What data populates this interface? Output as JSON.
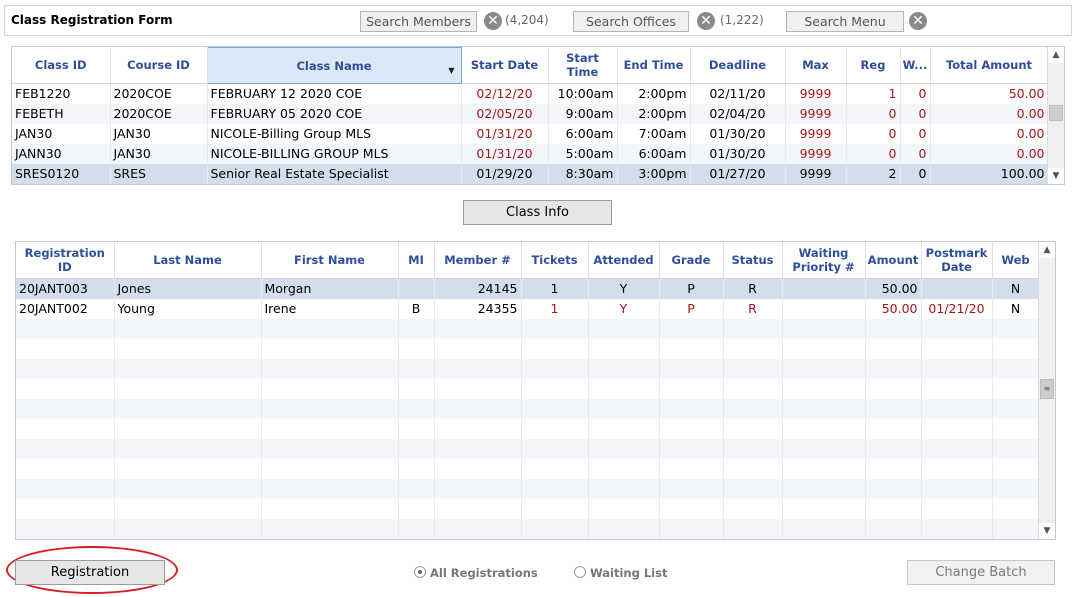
{
  "form_title": "Class Registration Form",
  "search": {
    "members_label": "Search Members",
    "members_count": "(4,204)",
    "offices_label": "Search Offices",
    "offices_count": "(1,222)",
    "menu_label": "Search Menu"
  },
  "classes": {
    "headers": {
      "class_id": "Class ID",
      "course_id": "Course ID",
      "class_name": "Class Name",
      "start_date": "Start Date",
      "start_time": "Start Time",
      "end_time": "End Time",
      "deadline": "Deadline",
      "max": "Max",
      "reg": "Reg",
      "w": "W...",
      "total_amount": "Total Amount"
    },
    "rows": [
      {
        "class_id": "FEB1220",
        "course_id": "2020COE",
        "class_name": "FEBRUARY 12 2020 COE",
        "start_date": "02/12/20",
        "start_time": "10:00am",
        "end_time": "2:00pm",
        "deadline": "02/11/20",
        "max": "9999",
        "reg": "1",
        "w": "0",
        "total": "50.00"
      },
      {
        "class_id": "FEBETH",
        "course_id": "2020COE",
        "class_name": "FEBRUARY 05 2020 COE",
        "start_date": "02/05/20",
        "start_time": "9:00am",
        "end_time": "2:00pm",
        "deadline": "02/04/20",
        "max": "9999",
        "reg": "0",
        "w": "0",
        "total": "0.00"
      },
      {
        "class_id": "JAN30",
        "course_id": "JAN30",
        "class_name": "NICOLE-Billing Group MLS",
        "start_date": "01/31/20",
        "start_time": "6:00am",
        "end_time": "7:00am",
        "deadline": "01/30/20",
        "max": "9999",
        "reg": "0",
        "w": "0",
        "total": "0.00"
      },
      {
        "class_id": "JANN30",
        "course_id": "JAN30",
        "class_name": "NICOLE-BILLING GROUP MLS",
        "start_date": "01/31/20",
        "start_time": "5:00am",
        "end_time": "6:00am",
        "deadline": "01/30/20",
        "max": "9999",
        "reg": "0",
        "w": "0",
        "total": "0.00"
      },
      {
        "class_id": "SRES0120",
        "course_id": "SRES",
        "class_name": "Senior Real Estate Specialist",
        "start_date": "01/29/20",
        "start_time": "8:30am",
        "end_time": "3:00pm",
        "deadline": "01/27/20",
        "max": "9999",
        "reg": "2",
        "w": "0",
        "total": "100.00"
      }
    ]
  },
  "class_info_button": "Class Info",
  "registrations": {
    "headers": {
      "registration_id": "Registration ID",
      "last_name": "Last Name",
      "first_name": "First Name",
      "mi": "MI",
      "member_no": "Member #",
      "tickets": "Tickets",
      "attended": "Attended",
      "grade": "Grade",
      "status": "Status",
      "waiting_priority": "Waiting Priority #",
      "amount": "Amount",
      "postmark_date": "Postmark Date",
      "web": "Web"
    },
    "rows": [
      {
        "registration_id": "20JANT003",
        "last_name": "Jones",
        "first_name": "Morgan",
        "mi": "",
        "member_no": "24145",
        "tickets": "1",
        "attended": "Y",
        "grade": "P",
        "status": "R",
        "waiting_priority": "",
        "amount": "50.00",
        "postmark_date": "",
        "web": "N"
      },
      {
        "registration_id": "20JANT002",
        "last_name": "Young",
        "first_name": "Irene",
        "mi": "B",
        "member_no": "24355",
        "tickets": "1",
        "attended": "Y",
        "grade": "P",
        "status": "R",
        "waiting_priority": "",
        "amount": "50.00",
        "postmark_date": "01/21/20",
        "web": "N"
      }
    ]
  },
  "registration_button": "Registration",
  "filter": {
    "all_label": "All Registrations",
    "waiting_label": "Waiting List",
    "selected": "All Registrations"
  },
  "change_batch_button": "Change Batch",
  "colors": {
    "header_text": "#2f4f9a",
    "red_value": "#a31818",
    "selected_row": "#d3deed",
    "alt_row": "#f3f7fc",
    "annotation_oval": "#d32020"
  }
}
